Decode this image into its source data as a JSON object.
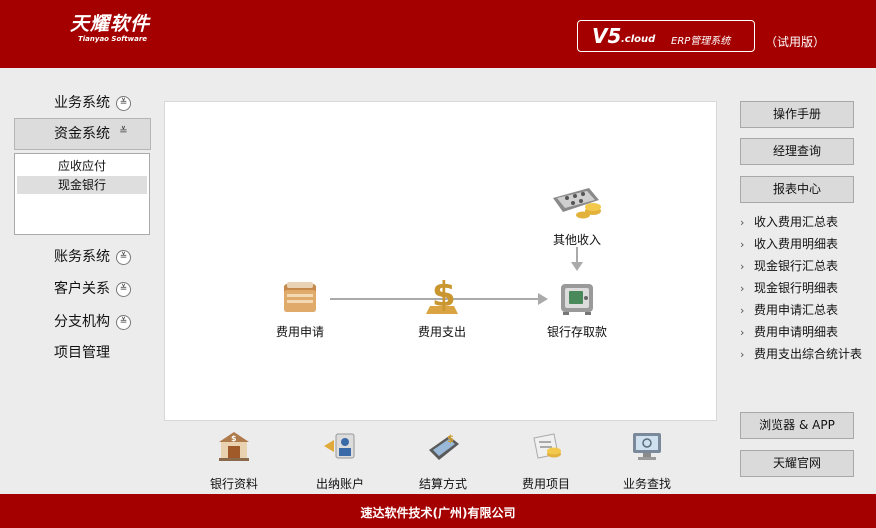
{
  "header": {
    "logo_cn": "天耀软件",
    "logo_en": "Tianyao Software",
    "product_version": "V5",
    "product_cloud": ".cloud",
    "product_name": "ERP管理系统",
    "trial": "（试用版）"
  },
  "nav": {
    "items": [
      {
        "label": "业务系统"
      },
      {
        "label": "资金系统"
      },
      {
        "label": "账务系统"
      },
      {
        "label": "客户关系"
      },
      {
        "label": "分支机构"
      },
      {
        "label": "项目管理"
      }
    ],
    "submenu": [
      {
        "label": "应收应付"
      },
      {
        "label": "现金银行"
      }
    ]
  },
  "flow": {
    "expense_request": "费用申请",
    "expense_payment": "费用支出",
    "bank_deposit": "银行存取款",
    "other_income": "其他收入"
  },
  "tools": [
    {
      "label": "银行资料"
    },
    {
      "label": "出纳账户"
    },
    {
      "label": "结算方式"
    },
    {
      "label": "费用项目"
    },
    {
      "label": "业务查找"
    }
  ],
  "right": {
    "manual": "操作手册",
    "manager_query": "经理查询",
    "report_center": "报表中心",
    "reports": [
      {
        "label": "收入费用汇总表"
      },
      {
        "label": "收入费用明细表"
      },
      {
        "label": "现金银行汇总表"
      },
      {
        "label": "现金银行明细表"
      },
      {
        "label": "费用申请汇总表"
      },
      {
        "label": "费用申请明细表"
      },
      {
        "label": "费用支出综合统计表"
      }
    ],
    "browser_app": "浏览器 & APP",
    "official_site": "天耀官网"
  },
  "footer": {
    "company": "速达软件技术(广州)有限公司"
  },
  "colors": {
    "brand_red": "#a50000",
    "background": "#ececec"
  }
}
